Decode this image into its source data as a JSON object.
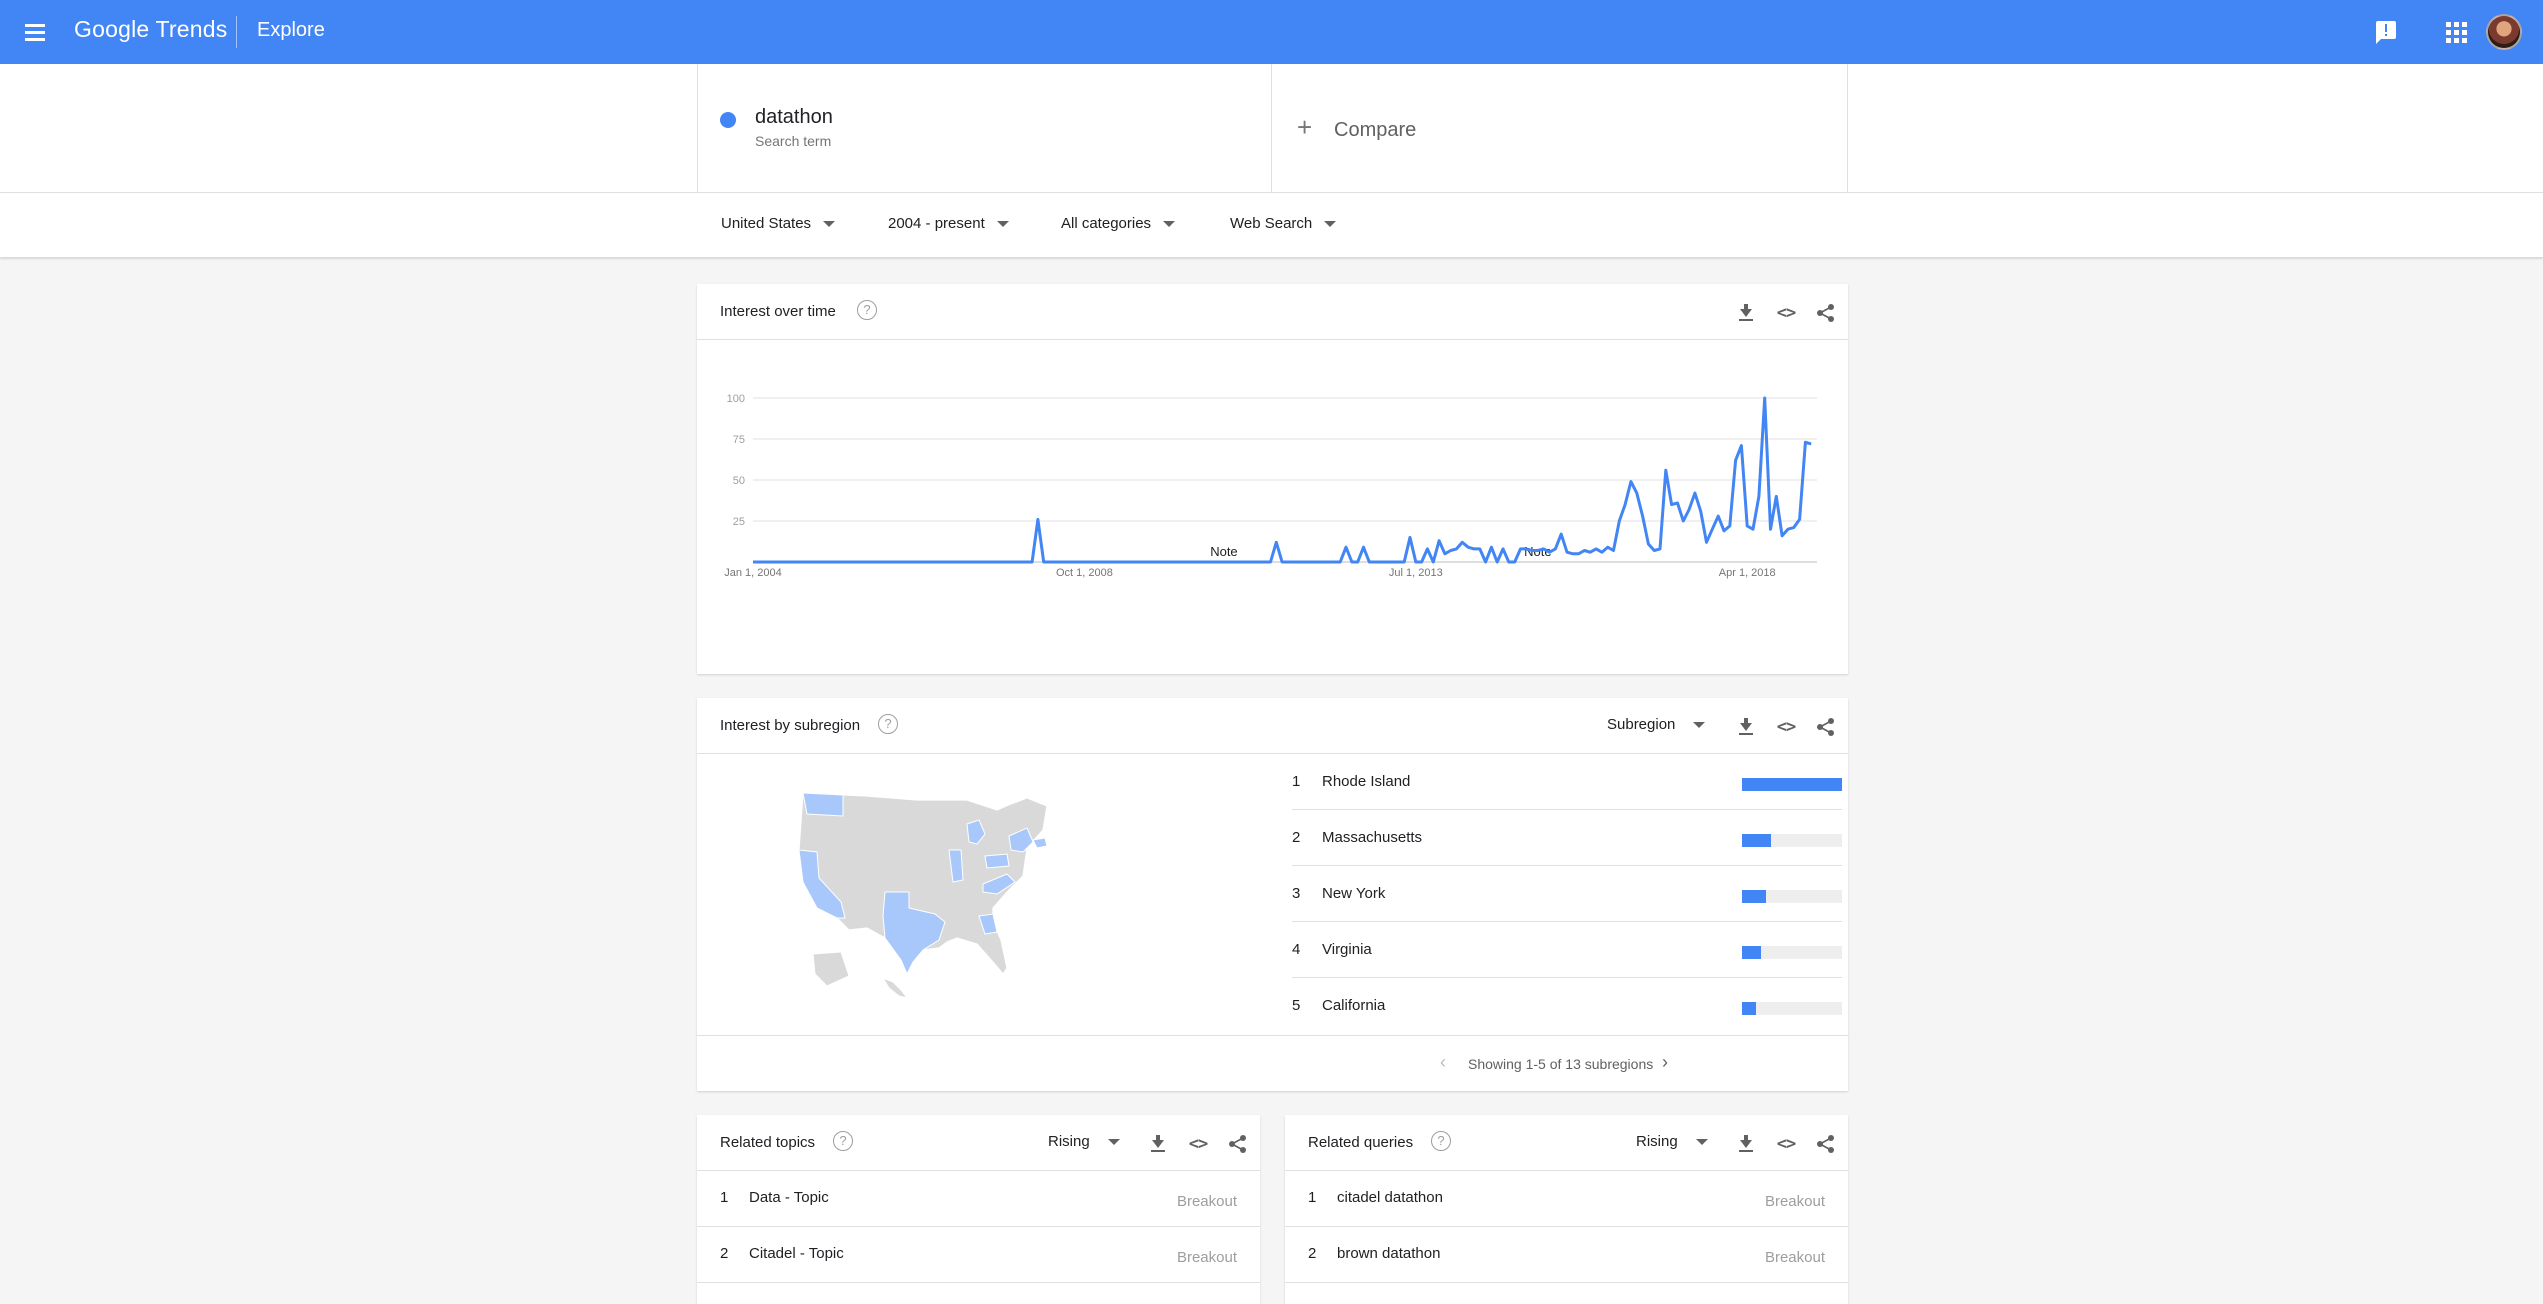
{
  "header": {
    "logo": "Google Trends",
    "section": "Explore"
  },
  "search": {
    "term": "datathon",
    "term_type": "Search term",
    "term_color": "#4285f4",
    "compare_label": "Compare"
  },
  "filters": {
    "region": "United States",
    "time": "2004 - present",
    "category": "All categories",
    "property": "Web Search"
  },
  "interest_over_time": {
    "title": "Interest over time",
    "notes": [
      "Note",
      "Note"
    ]
  },
  "chart_data": {
    "type": "line",
    "title": "Interest over time",
    "xlabel": "",
    "ylabel": "",
    "ylim": [
      0,
      100
    ],
    "y_ticks": [
      25,
      50,
      75,
      100
    ],
    "x_tick_labels": [
      "Jan 1, 2004",
      "Oct 1, 2008",
      "Jul 1, 2013",
      "Apr 1, 2018"
    ],
    "x_range": [
      "2004-01",
      "2019-01"
    ],
    "grid": true,
    "series": [
      {
        "color": "#4285f4",
        "points": [
          [
            "2004-01",
            0
          ],
          [
            "2007-12",
            0
          ],
          [
            "2008-01",
            0
          ],
          [
            "2008-02",
            26
          ],
          [
            "2008-03",
            0
          ],
          [
            "2011-05",
            0
          ],
          [
            "2011-06",
            0
          ],
          [
            "2011-07",
            12
          ],
          [
            "2011-08",
            0
          ],
          [
            "2012-06",
            0
          ],
          [
            "2012-07",
            9
          ],
          [
            "2012-08",
            0
          ],
          [
            "2012-09",
            0
          ],
          [
            "2012-10",
            9
          ],
          [
            "2012-11",
            0
          ],
          [
            "2013-05",
            0
          ],
          [
            "2013-06",
            15
          ],
          [
            "2013-07",
            0
          ],
          [
            "2013-08",
            0
          ],
          [
            "2013-09",
            8
          ],
          [
            "2013-10",
            0
          ],
          [
            "2013-11",
            13
          ],
          [
            "2013-12",
            5
          ],
          [
            "2014-01",
            7
          ],
          [
            "2014-02",
            8
          ],
          [
            "2014-03",
            12
          ],
          [
            "2014-04",
            9
          ],
          [
            "2014-05",
            8
          ],
          [
            "2014-06",
            8
          ],
          [
            "2014-07",
            0
          ],
          [
            "2014-08",
            9
          ],
          [
            "2014-09",
            0
          ],
          [
            "2014-10",
            8
          ],
          [
            "2014-11",
            0
          ],
          [
            "2014-12",
            0
          ],
          [
            "2015-01",
            8
          ],
          [
            "2015-02",
            8
          ],
          [
            "2015-03",
            7
          ],
          [
            "2015-04",
            7
          ],
          [
            "2015-05",
            8
          ],
          [
            "2015-06",
            6
          ],
          [
            "2015-07",
            8
          ],
          [
            "2015-08",
            17
          ],
          [
            "2015-09",
            6
          ],
          [
            "2015-10",
            5
          ],
          [
            "2015-11",
            5
          ],
          [
            "2015-12",
            7
          ],
          [
            "2016-01",
            6
          ],
          [
            "2016-02",
            8
          ],
          [
            "2016-03",
            6
          ],
          [
            "2016-04",
            9
          ],
          [
            "2016-05",
            7
          ],
          [
            "2016-06",
            25
          ],
          [
            "2016-07",
            35
          ],
          [
            "2016-08",
            49
          ],
          [
            "2016-09",
            42
          ],
          [
            "2016-10",
            28
          ],
          [
            "2016-11",
            11
          ],
          [
            "2016-12",
            7
          ],
          [
            "2017-01",
            8
          ],
          [
            "2017-02",
            56
          ],
          [
            "2017-03",
            35
          ],
          [
            "2017-04",
            36
          ],
          [
            "2017-05",
            25
          ],
          [
            "2017-06",
            32
          ],
          [
            "2017-07",
            42
          ],
          [
            "2017-08",
            31
          ],
          [
            "2017-09",
            12
          ],
          [
            "2017-10",
            20
          ],
          [
            "2017-11",
            28
          ],
          [
            "2017-12",
            19
          ],
          [
            "2018-01",
            22
          ],
          [
            "2018-02",
            62
          ],
          [
            "2018-03",
            71
          ],
          [
            "2018-04",
            22
          ],
          [
            "2018-05",
            20
          ],
          [
            "2018-06",
            40
          ],
          [
            "2018-07",
            100
          ],
          [
            "2018-08",
            20
          ],
          [
            "2018-09",
            40
          ],
          [
            "2018-10",
            16
          ],
          [
            "2018-11",
            20
          ],
          [
            "2018-12",
            21
          ],
          [
            "2019-01",
            26
          ],
          [
            "2019-02",
            73
          ],
          [
            "2019-03",
            72
          ]
        ]
      }
    ]
  },
  "subregion": {
    "title": "Interest by subregion",
    "dropdown": "Subregion",
    "items": [
      {
        "rank": "1",
        "name": "Rhode Island",
        "value": "100",
        "fraction": 1.0
      },
      {
        "rank": "2",
        "name": "Massachusetts",
        "value": "29",
        "fraction": 0.29
      },
      {
        "rank": "3",
        "name": "New York",
        "value": "24",
        "fraction": 0.24
      },
      {
        "rank": "4",
        "name": "Virginia",
        "value": "19",
        "fraction": 0.19
      },
      {
        "rank": "5",
        "name": "California",
        "value": "14",
        "fraction": 0.14
      }
    ],
    "pager_text": "Showing 1-5 of 13 subregions"
  },
  "related_topics": {
    "title": "Related topics",
    "dropdown": "Rising",
    "items": [
      {
        "rank": "1",
        "name": "Data - Topic",
        "value": "Breakout"
      },
      {
        "rank": "2",
        "name": "Citadel - Topic",
        "value": "Breakout"
      }
    ]
  },
  "related_queries": {
    "title": "Related queries",
    "dropdown": "Rising",
    "items": [
      {
        "rank": "1",
        "name": "citadel datathon",
        "value": "Breakout"
      },
      {
        "rank": "2",
        "name": "brown datathon",
        "value": "Breakout"
      }
    ]
  },
  "colors": {
    "brand": "#4285f4",
    "map_highlight": "#a8c7fa",
    "map_base": "#d9d9d9"
  }
}
